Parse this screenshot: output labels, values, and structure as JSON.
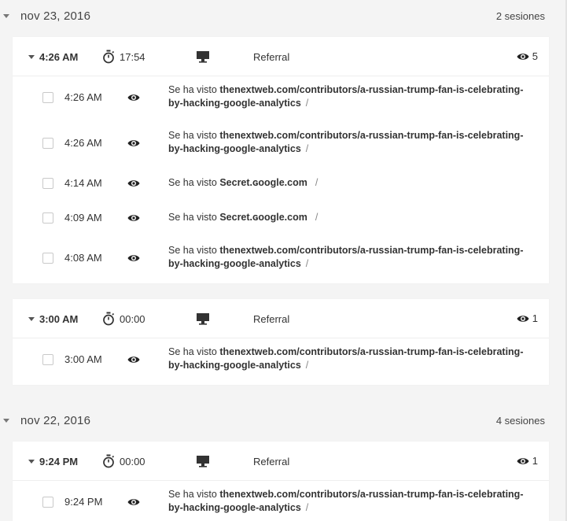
{
  "days": [
    {
      "date": "nov 23, 2016",
      "count": "2 sesiones",
      "sessions": [
        {
          "time": "4:26 AM",
          "duration": "17:54",
          "source": "Referral",
          "views": "5",
          "hits": [
            {
              "time": "4:26 AM",
              "prefix": "Se ha visto",
              "url": "thenextweb.com/contributors/a-russian-trump-fan-is-celebrating-by-hacking-google-analytics",
              "sep": "/"
            },
            {
              "time": "4:26 AM",
              "prefix": "Se ha visto",
              "url": "thenextweb.com/contributors/a-russian-trump-fan-is-celebrating-by-hacking-google-analytics",
              "sep": "/"
            },
            {
              "time": "4:14 AM",
              "prefix": "Se ha visto",
              "url": "Secret.ɢoogle.com",
              "sep": "/"
            },
            {
              "time": "4:09 AM",
              "prefix": "Se ha visto",
              "url": "Secret.ɢoogle.com",
              "sep": "/"
            },
            {
              "time": "4:08 AM",
              "prefix": "Se ha visto",
              "url": "thenextweb.com/contributors/a-russian-trump-fan-is-celebrating-by-hacking-google-analytics",
              "sep": "/"
            }
          ]
        },
        {
          "time": "3:00 AM",
          "duration": "00:00",
          "source": "Referral",
          "views": "1",
          "hits": [
            {
              "time": "3:00 AM",
              "prefix": "Se ha visto",
              "url": "thenextweb.com/contributors/a-russian-trump-fan-is-celebrating-by-hacking-google-analytics",
              "sep": "/"
            }
          ]
        }
      ]
    },
    {
      "date": "nov 22, 2016",
      "count": "4 sesiones",
      "sessions": [
        {
          "time": "9:24 PM",
          "duration": "00:00",
          "source": "Referral",
          "views": "1",
          "hits": [
            {
              "time": "9:24 PM",
              "prefix": "Se ha visto",
              "url": "thenextweb.com/contributors/a-russian-trump-fan-is-celebrating-by-hacking-google-analytics",
              "sep": "/"
            }
          ]
        }
      ]
    }
  ],
  "icons": {
    "collapse": "caret-down-icon",
    "duration": "timer-icon",
    "device": "desktop-icon",
    "views": "eye-icon",
    "select": "checkbox"
  }
}
